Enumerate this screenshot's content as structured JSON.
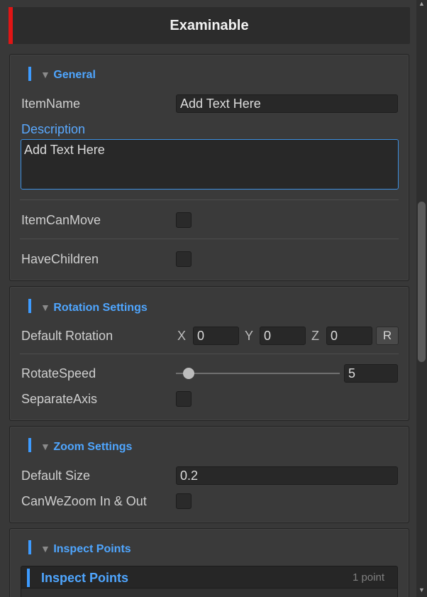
{
  "header": {
    "title": "Examinable",
    "accent_color": "#e01515"
  },
  "general": {
    "title": "General",
    "item_name_label": "ItemName",
    "item_name_value": "Add Text Here",
    "description_label": "Description",
    "description_value": "Add Text Here",
    "item_can_move_label": "ItemCanMove",
    "have_children_label": "HaveChildren"
  },
  "rotation": {
    "title": "Rotation Settings",
    "default_rotation_label": "Default Rotation",
    "x_label": "X",
    "x_value": "0",
    "y_label": "Y",
    "y_value": "0",
    "z_label": "Z",
    "z_value": "0",
    "reset_label": "R",
    "rotate_speed_label": "RotateSpeed",
    "rotate_speed_value": "5",
    "rotate_speed_fraction": 0.08,
    "separate_axis_label": "SeparateAxis"
  },
  "zoom": {
    "title": "Zoom Settings",
    "default_size_label": "Default Size",
    "default_size_value": "0.2",
    "can_zoom_label": "CanWeZoom In & Out"
  },
  "inspect": {
    "title": "Inspect Points",
    "list_title": "Inspect Points",
    "list_count": "1 point"
  },
  "icons": {
    "foldout": "triangle-down-icon",
    "scroll_up": "arrow-up-icon",
    "scroll_down": "arrow-down-icon"
  },
  "colors": {
    "accent_blue": "#3d9bff",
    "section_title": "#4fa6ff"
  }
}
